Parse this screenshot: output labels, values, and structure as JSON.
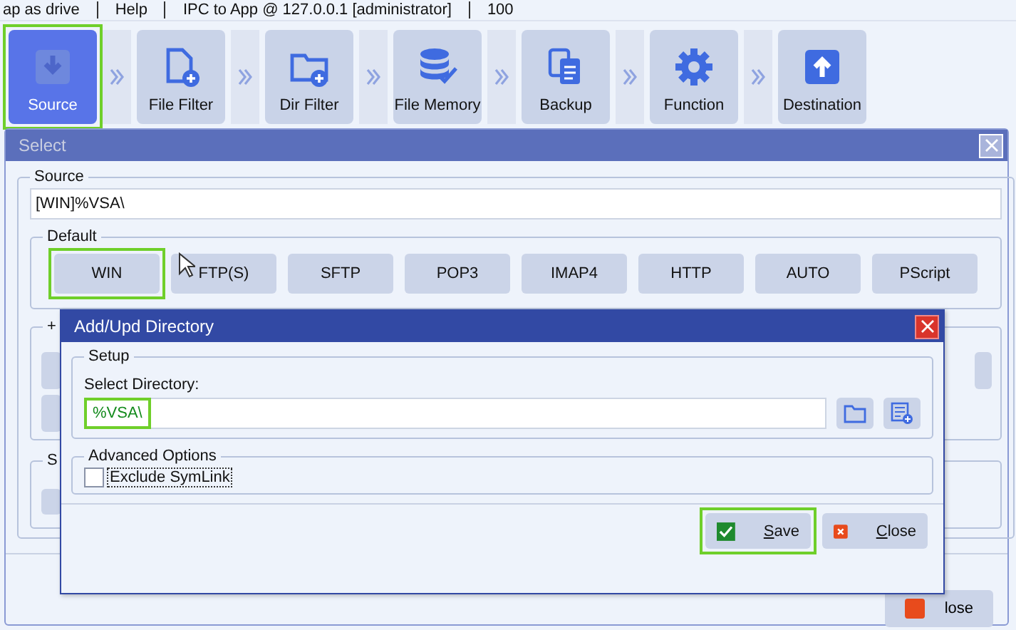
{
  "menu_bar": [
    {
      "label": "ap as drive"
    },
    {
      "label": "Help"
    },
    {
      "label": "IPC to App @ 127.0.0.1 [administrator]"
    },
    {
      "label": "100"
    }
  ],
  "steps": [
    {
      "kind": "download",
      "label": "Source",
      "selected": true,
      "highlighted": true
    },
    {
      "kind": "file-add",
      "label": "File Filter",
      "selected": false,
      "highlighted": false
    },
    {
      "kind": "folder-add",
      "label": "Dir Filter",
      "selected": false,
      "highlighted": false
    },
    {
      "kind": "database",
      "label": "File Memory",
      "selected": false,
      "highlighted": false
    },
    {
      "kind": "copy",
      "label": "Backup",
      "selected": false,
      "highlighted": false
    },
    {
      "kind": "gear",
      "label": "Function",
      "selected": false,
      "highlighted": false
    },
    {
      "kind": "upload",
      "label": "Destination",
      "selected": false,
      "highlighted": false
    }
  ],
  "select_window": {
    "title": "Select",
    "source": {
      "legend": "Source",
      "value": "[WIN]%VSA\\"
    },
    "default": {
      "legend": "Default",
      "buttons": [
        {
          "label": "WIN",
          "highlighted": true
        },
        {
          "label": "FTP(S)",
          "highlighted": false
        },
        {
          "label": "SFTP",
          "highlighted": false
        },
        {
          "label": "POP3",
          "highlighted": false
        },
        {
          "label": "IMAP4",
          "highlighted": false
        },
        {
          "label": "HTTP",
          "highlighted": false
        },
        {
          "label": "AUTO",
          "highlighted": false
        },
        {
          "label": "PScript",
          "highlighted": false
        }
      ]
    },
    "group_3": {
      "legend": "+"
    },
    "group_4": {
      "legend": "S"
    },
    "close_button": "lose"
  },
  "dialog": {
    "title": "Add/Upd Directory",
    "setup": {
      "legend": "Setup",
      "label": "Select Directory:",
      "value": "%VSA\\",
      "highlighted": true
    },
    "advanced": {
      "legend": "Advanced  Options",
      "options": [
        {
          "label": "Exclude SymLink",
          "checked": false
        }
      ]
    },
    "buttons": [
      {
        "kind": "save",
        "label": "Save",
        "highlighted": true
      },
      {
        "kind": "close",
        "label": "Close",
        "highlighted": false
      }
    ]
  }
}
